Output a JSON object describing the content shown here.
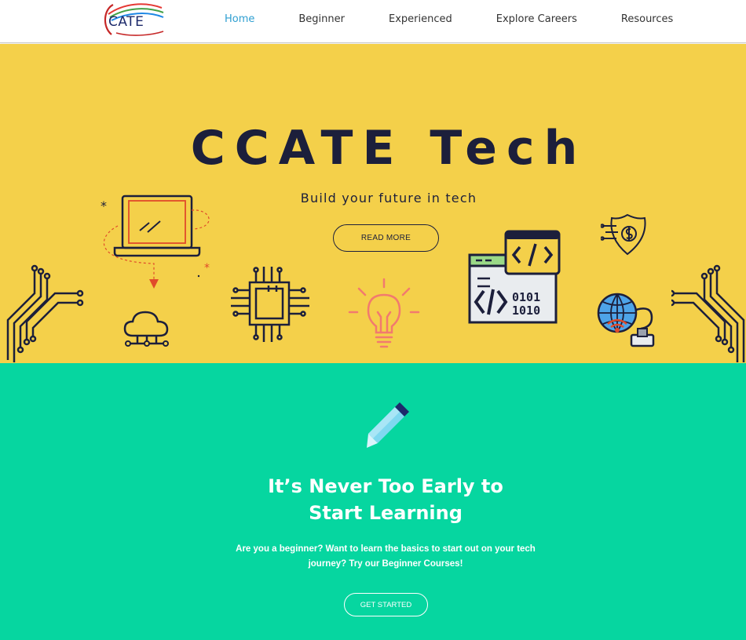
{
  "header": {
    "logo_text": "CATE",
    "nav": [
      {
        "label": "Home",
        "active": true
      },
      {
        "label": "Beginner",
        "active": false
      },
      {
        "label": "Experienced",
        "active": false
      },
      {
        "label": "Explore Careers",
        "active": false
      },
      {
        "label": "Resources",
        "active": false
      }
    ]
  },
  "hero": {
    "title": "CCATE Tech",
    "subtitle": "Build your future in tech",
    "button_label": "READ MORE",
    "background": "#f4d04a",
    "icons": [
      "circuit-icon",
      "laptop-icon",
      "cloud-icon",
      "chip-icon",
      "lightbulb-icon",
      "code-window-icon",
      "binary-code-icon",
      "shield-dollar-icon",
      "globe-network-icon"
    ]
  },
  "learn": {
    "icon": "pencil-icon",
    "title_line1": "It’s Never Too Early to",
    "title_line2": "Start Learning",
    "text": "Are you a beginner? Want to learn the basics to start out on your tech journey? Try our Beginner Courses!",
    "button_label": "GET STARTED",
    "background": "#06d6a0"
  }
}
